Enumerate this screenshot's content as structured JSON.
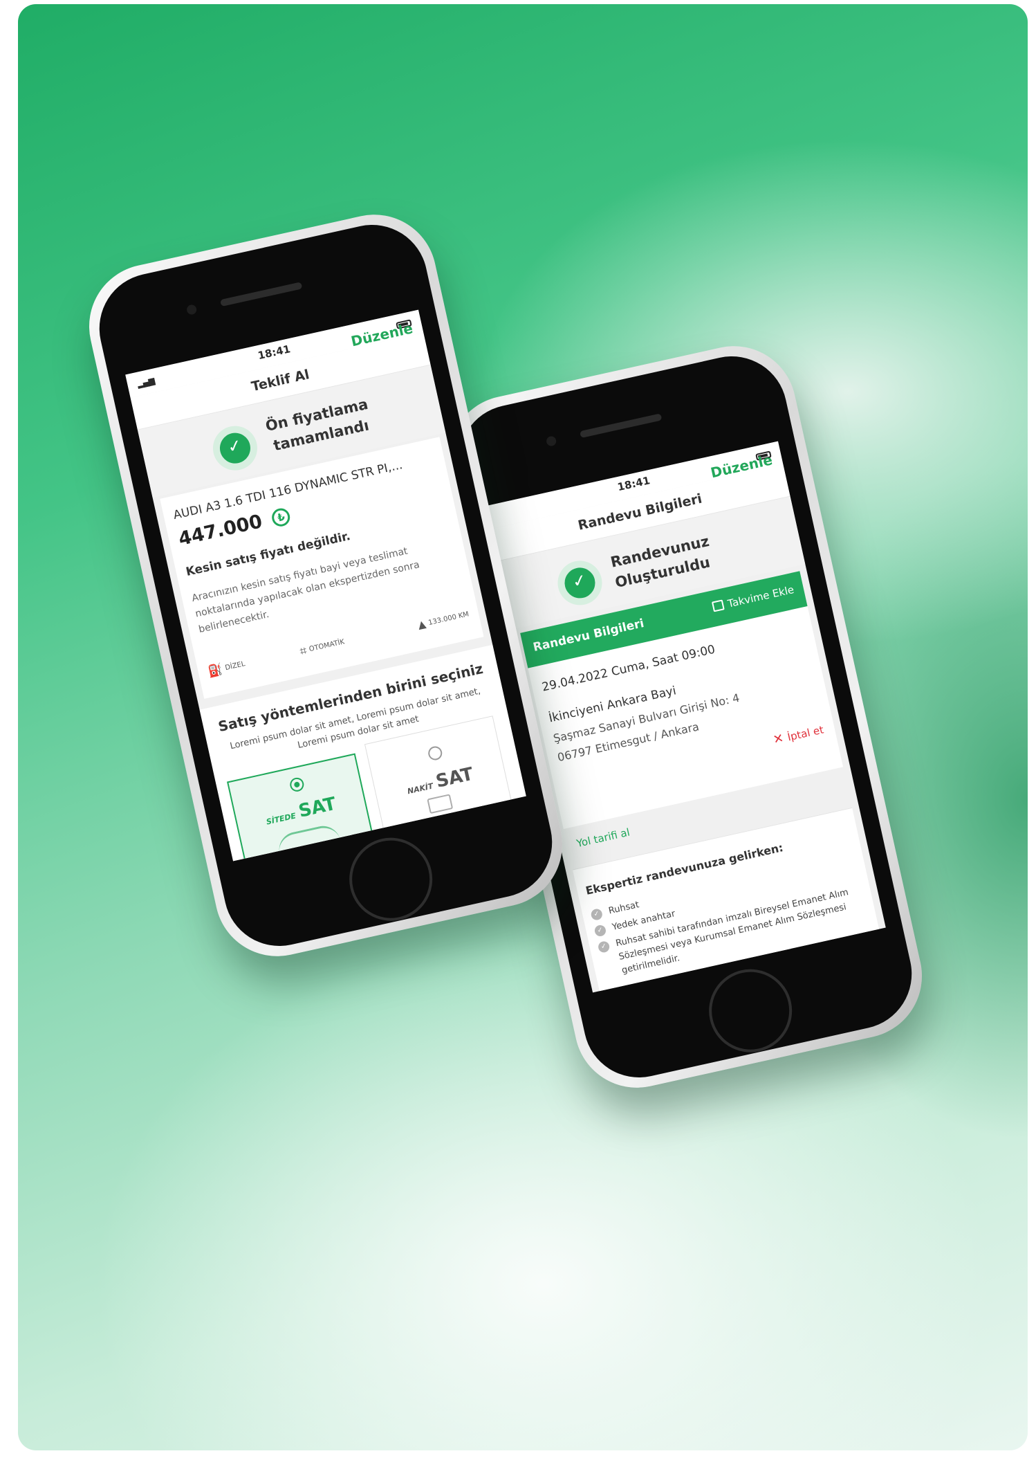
{
  "phone_left": {
    "status_time": "18:41",
    "nav_title": "Teklif Al",
    "edit_label": "Düzenle",
    "success_title_line1": "Ön fiyatlama",
    "success_title_line2": "tamamlandı",
    "car_name": "AUDI A3 1.6 TDI 116 DYNAMIC STR PI,...",
    "price": "447.000",
    "currency_symbol": "₺",
    "notice_title": "Kesin satış fiyatı değildir.",
    "notice_text": "Aracınızın kesin satış fiyatı bayi veya teslimat noktalarında yapılacak olan ekspertizden sonra belirlenecektir.",
    "specs": {
      "fuel": "DİZEL",
      "gear": "OTOMATİK",
      "km": "133.000 KM"
    },
    "method_heading": "Satış yöntemlerinden birini seçiniz",
    "method_desc": "Loremi psum dolar sit amet, Loremi psum dolar sit amet, Loremi psum dolar sit amet",
    "option_site": {
      "small": "SİTEDE",
      "big": "SAT",
      "selected": true
    },
    "option_cash": {
      "small": "NAKİT",
      "big": "SAT",
      "selected": false
    }
  },
  "phone_right": {
    "status_time": "18:41",
    "nav_title": "Randevu Bilgileri",
    "edit_label": "Düzenle",
    "success_title_line1": "Randevunuz",
    "success_title_line2": "Oluşturuldu",
    "add_calendar": "Takvime Ekle",
    "section_title": "Randevu Bilgileri",
    "date_line": "29.04.2022 Cuma, Saat 09:00",
    "dealer_name": "İkinciyeni Ankara Bayi",
    "address_line1": "Şaşmaz Sanayi Bulvarı Girişi No: 4",
    "address_line2": "06797 Etimesgut / Ankara",
    "cancel_label": "İptal et",
    "directions_label": "Yol tarifi al",
    "checklist_title": "Ekspertiz randevunuza gelirken:",
    "checklist": [
      "Ruhsat",
      "Yedek anahtar",
      "Ruhsat sahibi tarafından imzalı Bireysel Emanet Alım Sözleşmesi veya Kurumsal Emanet Alım Sözleşmesi getirilmelidir."
    ]
  },
  "colors": {
    "brand_green": "#1fa85a",
    "danger_red": "#e0303a"
  }
}
